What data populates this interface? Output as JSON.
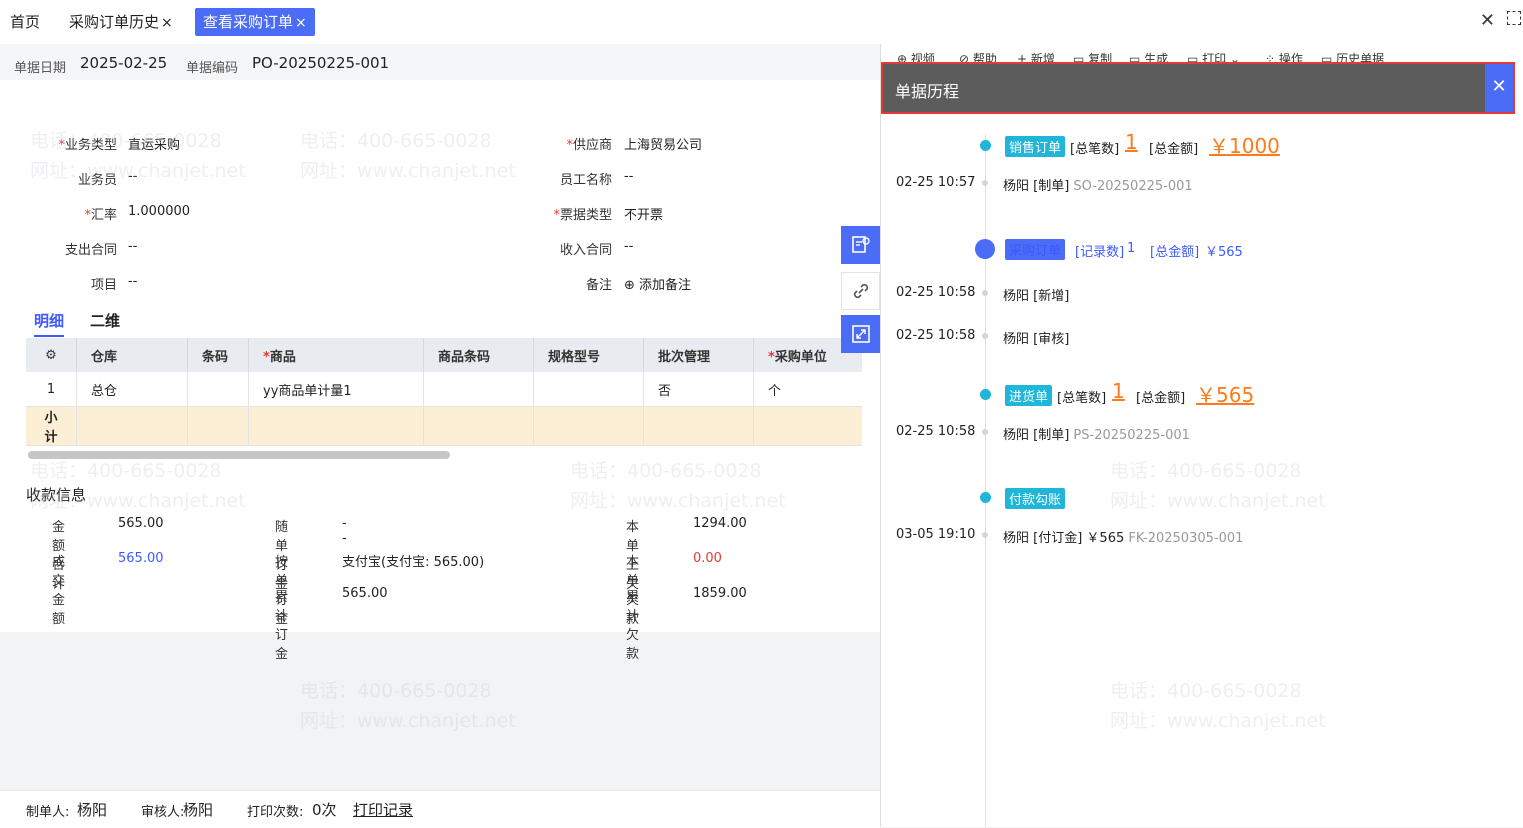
{
  "tabs": [
    {
      "label": "首页",
      "active": false,
      "closable": false
    },
    {
      "label": "采购订单历史",
      "active": false,
      "closable": true
    },
    {
      "label": "查看采购订单",
      "active": true,
      "closable": true
    }
  ],
  "header": {
    "date_label": "单据日期",
    "date_value": "2025-02-25",
    "code_label": "单据编码",
    "code_value": "PO-20250225-001"
  },
  "toolbar": [
    "视频",
    "帮助",
    "新增",
    "复制",
    "生成",
    "打印",
    "操作",
    "历史单据"
  ],
  "form": {
    "business_type": {
      "label": "业务类型",
      "value": "直运采购"
    },
    "salesperson": {
      "label": "业务员",
      "value": "--"
    },
    "exchange_rate": {
      "label": "汇率",
      "value": "1.000000"
    },
    "expense_contract": {
      "label": "支出合同",
      "value": "--"
    },
    "project": {
      "label": "项目",
      "value": "--"
    },
    "supplier": {
      "label": "供应商",
      "value": "上海贸易公司"
    },
    "employee": {
      "label": "员工名称",
      "value": "--"
    },
    "invoice_type": {
      "label": "票据类型",
      "value": "不开票"
    },
    "income_contract": {
      "label": "收入合同",
      "value": "--"
    },
    "remark": {
      "label": "备注",
      "action": "添加备注"
    }
  },
  "detail_tabs": [
    "明细",
    "二维"
  ],
  "table": {
    "columns": [
      "仓库",
      "条码",
      "商品",
      "商品条码",
      "规格型号",
      "批次管理",
      "采购单位"
    ],
    "rows": [
      {
        "index": "1",
        "warehouse": "总仓",
        "barcode": "",
        "product": "yy商品单计量1",
        "product_barcode": "",
        "spec": "",
        "batch": "否",
        "unit": "个"
      }
    ],
    "subtotal_label": "小计"
  },
  "payment": {
    "title": "收款信息",
    "total_amount": {
      "label": "金额合计",
      "value": "565.00"
    },
    "deal_amount": {
      "label": "成交金额",
      "value": "565.00"
    },
    "with_order": {
      "label": "随单订金",
      "value": "--"
    },
    "by_order": {
      "label": "按单订金",
      "value": "支付宝(支付宝: 565.00)"
    },
    "acc_order": {
      "label": "累计订金",
      "value": "565.00"
    },
    "prev_debt": {
      "label": "本单上欠",
      "value": "1294.00"
    },
    "this_debt": {
      "label": "本单欠款",
      "value": "0.00"
    },
    "acc_debt": {
      "label": "累计欠款",
      "value": "1859.00"
    }
  },
  "footer": {
    "maker_label": "制单人:",
    "maker": "杨阳",
    "auditor_label": "审核人:",
    "auditor": "杨阳",
    "print_label": "打印次数:",
    "print_count": "0次",
    "print_log": "打印记录"
  },
  "history": {
    "title": "单据历程",
    "events": [
      {
        "tag": "销售订单",
        "stat1_label": "[总笔数]",
        "stat1_value": "1",
        "stat2_label": "[总金额]",
        "stat2_value": "￥1000",
        "time": "02-25 10:57",
        "desc": "杨阳 [制单]",
        "code": "SO-20250225-001"
      },
      {
        "tag": "采购订单",
        "stat1_label": "[记录数]",
        "stat1_value": "1",
        "stat2_label": "[总金额]",
        "stat2_value": "￥565",
        "time1": "02-25 10:58",
        "desc1": "杨阳 [新增]",
        "time2": "02-25 10:58",
        "desc2": "杨阳 [审核]"
      },
      {
        "tag": "进货单",
        "stat1_label": "[总笔数]",
        "stat1_value": "1",
        "stat2_label": "[总金额]",
        "stat2_value": "￥565",
        "time": "02-25 10:58",
        "desc": "杨阳 [制单]",
        "code": "PS-20250225-001"
      },
      {
        "tag": "付款勾账",
        "time": "03-05 19:10",
        "desc": "杨阳 [付订金]",
        "amount": "￥565",
        "code": "FK-20250305-001"
      }
    ]
  },
  "watermark": {
    "phone": "电话：400-665-0028",
    "site": "网址：www.chanjet.net"
  },
  "colors": {
    "accent": "#4a6cf7",
    "cyan": "#1fb6d9",
    "orange": "#ff7a1a",
    "red": "#e53935",
    "header_gray": "#5c5c5c"
  }
}
